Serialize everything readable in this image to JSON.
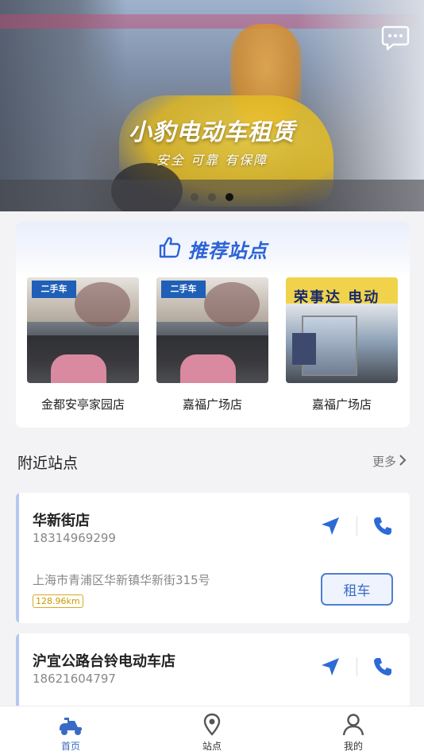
{
  "banner": {
    "title": "小豹电动车租赁",
    "subtitle": "安全  可靠  有保障",
    "dots": 3,
    "active_dot": 2
  },
  "recommended": {
    "title": "推荐站点",
    "items": [
      {
        "name": "金都安亭家园店",
        "sign": "二手车"
      },
      {
        "name": "嘉福广场店",
        "sign": "二手车"
      },
      {
        "name": "嘉福广场店",
        "sign": "荣事达 电动"
      }
    ]
  },
  "nearby": {
    "title": "附近站点",
    "more_label": "更多",
    "stations": [
      {
        "name": "华新街店",
        "phone": "18314969299",
        "address": "上海市青浦区华新镇华新街315号",
        "distance": "128.96km",
        "rent_label": "租车"
      },
      {
        "name": "沪宜公路台铃电动车店",
        "phone": "18621604797"
      }
    ]
  },
  "tabs": [
    {
      "label": "首页",
      "icon": "scooter-icon",
      "active": true
    },
    {
      "label": "站点",
      "icon": "location-pin-icon",
      "active": false
    },
    {
      "label": "我的",
      "icon": "person-icon",
      "active": false
    }
  ],
  "colors": {
    "accent": "#3a6bc4",
    "distance_badge": "#c99a00",
    "station_stripe": "#b6c8f0"
  }
}
